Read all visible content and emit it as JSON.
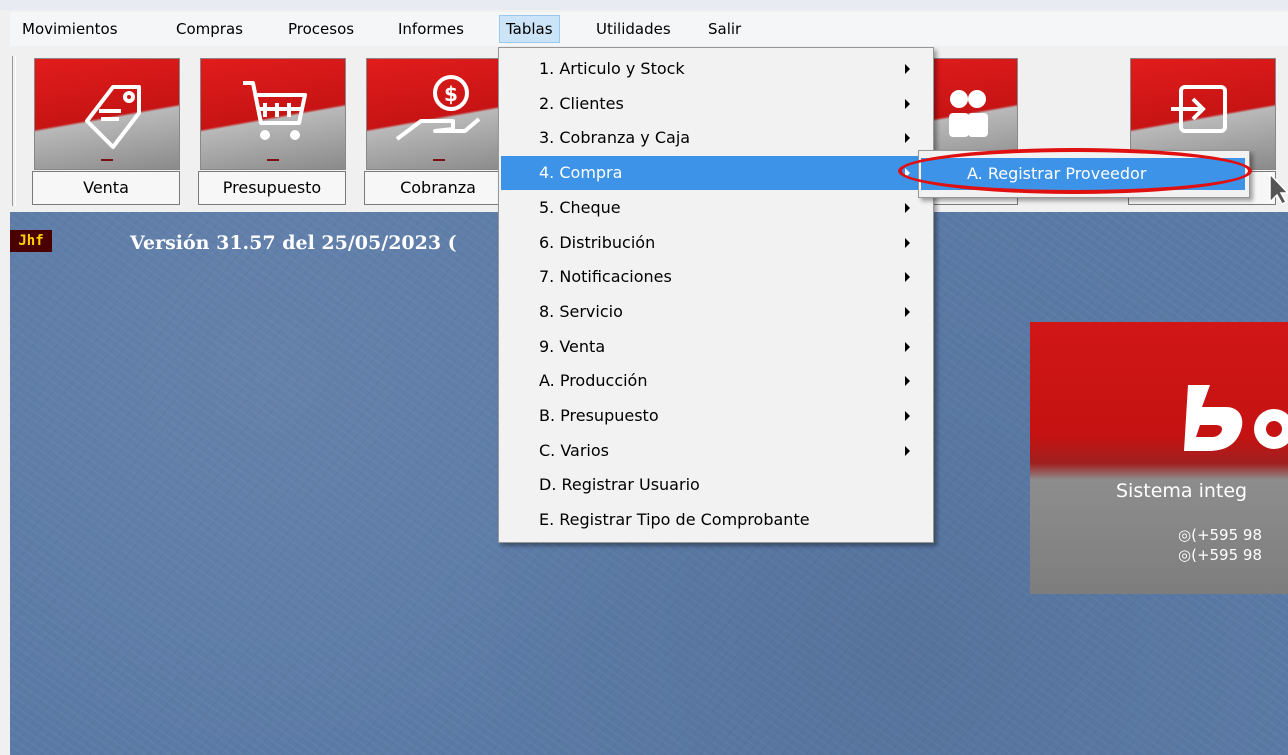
{
  "menubar": {
    "items": [
      {
        "label": "Movimientos"
      },
      {
        "label": "Compras"
      },
      {
        "label": "Procesos"
      },
      {
        "label": "Informes"
      },
      {
        "label": "Tablas"
      },
      {
        "label": "Utilidades"
      },
      {
        "label": "Salir"
      }
    ],
    "active": "Tablas"
  },
  "toolbar": {
    "buttons": [
      {
        "label": "Venta",
        "icon": "price-tag-icon"
      },
      {
        "label": "Presupuesto",
        "icon": "shopping-cart-icon"
      },
      {
        "label": "Cobranza",
        "icon": "hand-coin-icon"
      },
      {
        "label": "",
        "icon": "users-icon"
      },
      {
        "label": "",
        "icon": "exit-icon"
      }
    ]
  },
  "status": {
    "badge": "Jhf",
    "version": "Versión 31.57 del 25/05/2023 ("
  },
  "tablas_menu": {
    "items": [
      {
        "label": "1. Articulo y Stock",
        "submenu": true
      },
      {
        "label": "2. Clientes",
        "submenu": true
      },
      {
        "label": "3. Cobranza y Caja",
        "submenu": true
      },
      {
        "label": "4. Compra",
        "submenu": true,
        "highlighted": true
      },
      {
        "label": "5. Cheque",
        "submenu": true
      },
      {
        "label": "6. Distribución",
        "submenu": true
      },
      {
        "label": "7. Notificaciones",
        "submenu": true
      },
      {
        "label": "8. Servicio",
        "submenu": true
      },
      {
        "label": "9. Venta",
        "submenu": true
      },
      {
        "label": "A. Producción",
        "submenu": true
      },
      {
        "label": "B. Presupuesto",
        "submenu": true
      },
      {
        "label": "C. Varios",
        "submenu": true
      },
      {
        "label": "D. Registrar Usuario",
        "submenu": false
      },
      {
        "label": "E. Registrar Tipo de Comprobante",
        "submenu": false
      }
    ]
  },
  "compra_submenu": {
    "items": [
      {
        "label": "A. Registrar Proveedor",
        "highlighted": true
      }
    ]
  },
  "logo": {
    "brand": "bo",
    "tagline": "Sistema integ",
    "phones": [
      "(+595 98",
      "(+595 98"
    ]
  },
  "colors": {
    "highlight": "#3d93e8",
    "desktop": "#5a7aa6",
    "brand_red": "#d11616",
    "callout": "#e01010",
    "badge_bg": "#4a0000",
    "badge_fg": "#ffd200"
  }
}
